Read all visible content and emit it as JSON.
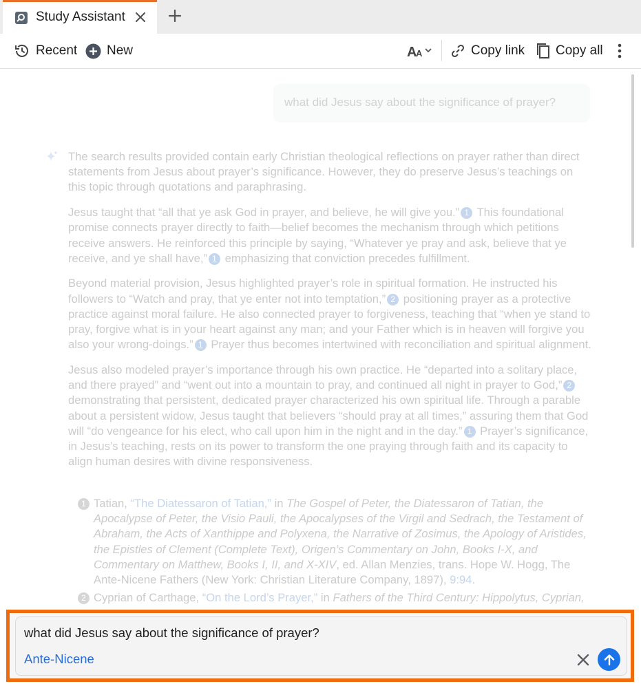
{
  "tab": {
    "title": "Study Assistant",
    "icon": "search-book-icon"
  },
  "toolbar": {
    "recent_label": "Recent",
    "new_label": "New",
    "copy_link_label": "Copy link",
    "copy_all_label": "Copy all"
  },
  "conversation": {
    "query": "what did Jesus say about the significance of prayer?",
    "answer": {
      "p1": "The search results provided contain early Christian theological reflections on prayer rather than direct statements from Jesus about prayer’s significance. However, they do preserve Jesus’s teachings on this topic through quotations and paraphrasing.",
      "p2a": "Jesus taught that “all that ye ask God in prayer, and believe, he will give you.”",
      "p2b": " This foundational promise connects prayer directly to faith—belief becomes the mechanism through which petitions receive answers. He reinforced this principle by saying, “Whatever ye pray and ask, believe that ye receive, and ye shall have,”",
      "p2c": " emphasizing that conviction precedes fulfillment.",
      "p3a": "Beyond material provision, Jesus highlighted prayer’s role in spiritual formation. He instructed his followers to “Watch and pray, that ye enter not into temptation,”",
      "p3b": " positioning prayer as a protective practice against moral failure. He also connected prayer to forgiveness, teaching that “when ye stand to pray, forgive what is in your heart against any man; and your Father which is in heaven will forgive you also your wrong-doings.”",
      "p3c": " Prayer thus becomes intertwined with reconciliation and spiritual alignment.",
      "p4a": "Jesus also modeled prayer’s importance through his own practice. He “departed into a solitary place, and there prayed” and “went out into a mountain to pray, and continued all night in prayer to God,”",
      "p4b": " demonstrating that persistent, dedicated prayer characterized his own spiritual life. Through a parable about a persistent widow, Jesus taught that believers “should pray at all times,” assuring them that God will “do vengeance for his elect, who call upon him in the night and in the day.”",
      "p4c": " Prayer’s significance, in Jesus’s teaching, rests on its power to transform the one praying through faith and its capacity to align human desires with divine responsiveness."
    },
    "citations": {
      "c1": "1",
      "c2": "2"
    },
    "references": [
      {
        "num": "1",
        "author": "Tatian, ",
        "link": "“The Diatessaron of Tatian,”",
        "in": " in ",
        "work": "The Gospel of Peter, the Diatessaron of Tatian, the Apocalypse of Peter, the Visio Pauli, the Apocalypses of the Virgil and Sedrach, the Testament of Abraham, the Acts of Xanthippe and Polyxena, the Narrative of Zosimus, the Apology of Aristides, the Epistles of Clement (Complete Text), Origen’s Commentary on John, Books I-X, and Commentary on Matthew, Books I, II, and X-XIV",
        "rest": ", ed. Allan Menzies, trans. Hope W. Hogg, The Ante-Nicene Fathers (New York: Christian Literature Company, 1897), ",
        "page": "9:94",
        "end": "."
      },
      {
        "num": "2",
        "author": "Cyprian of Carthage, ",
        "link": "“On the Lord’s Prayer,”",
        "in": " in ",
        "work": "Fathers of the Third Century: Hippolytus, Cyprian,"
      }
    ]
  },
  "input": {
    "text": "what did Jesus say about the significance of prayer?",
    "filter_chip": "Ante-Nicene"
  },
  "colors": {
    "accent": "#ee6c0e",
    "send": "#1a73e8",
    "chip": "#2a6dd4"
  }
}
